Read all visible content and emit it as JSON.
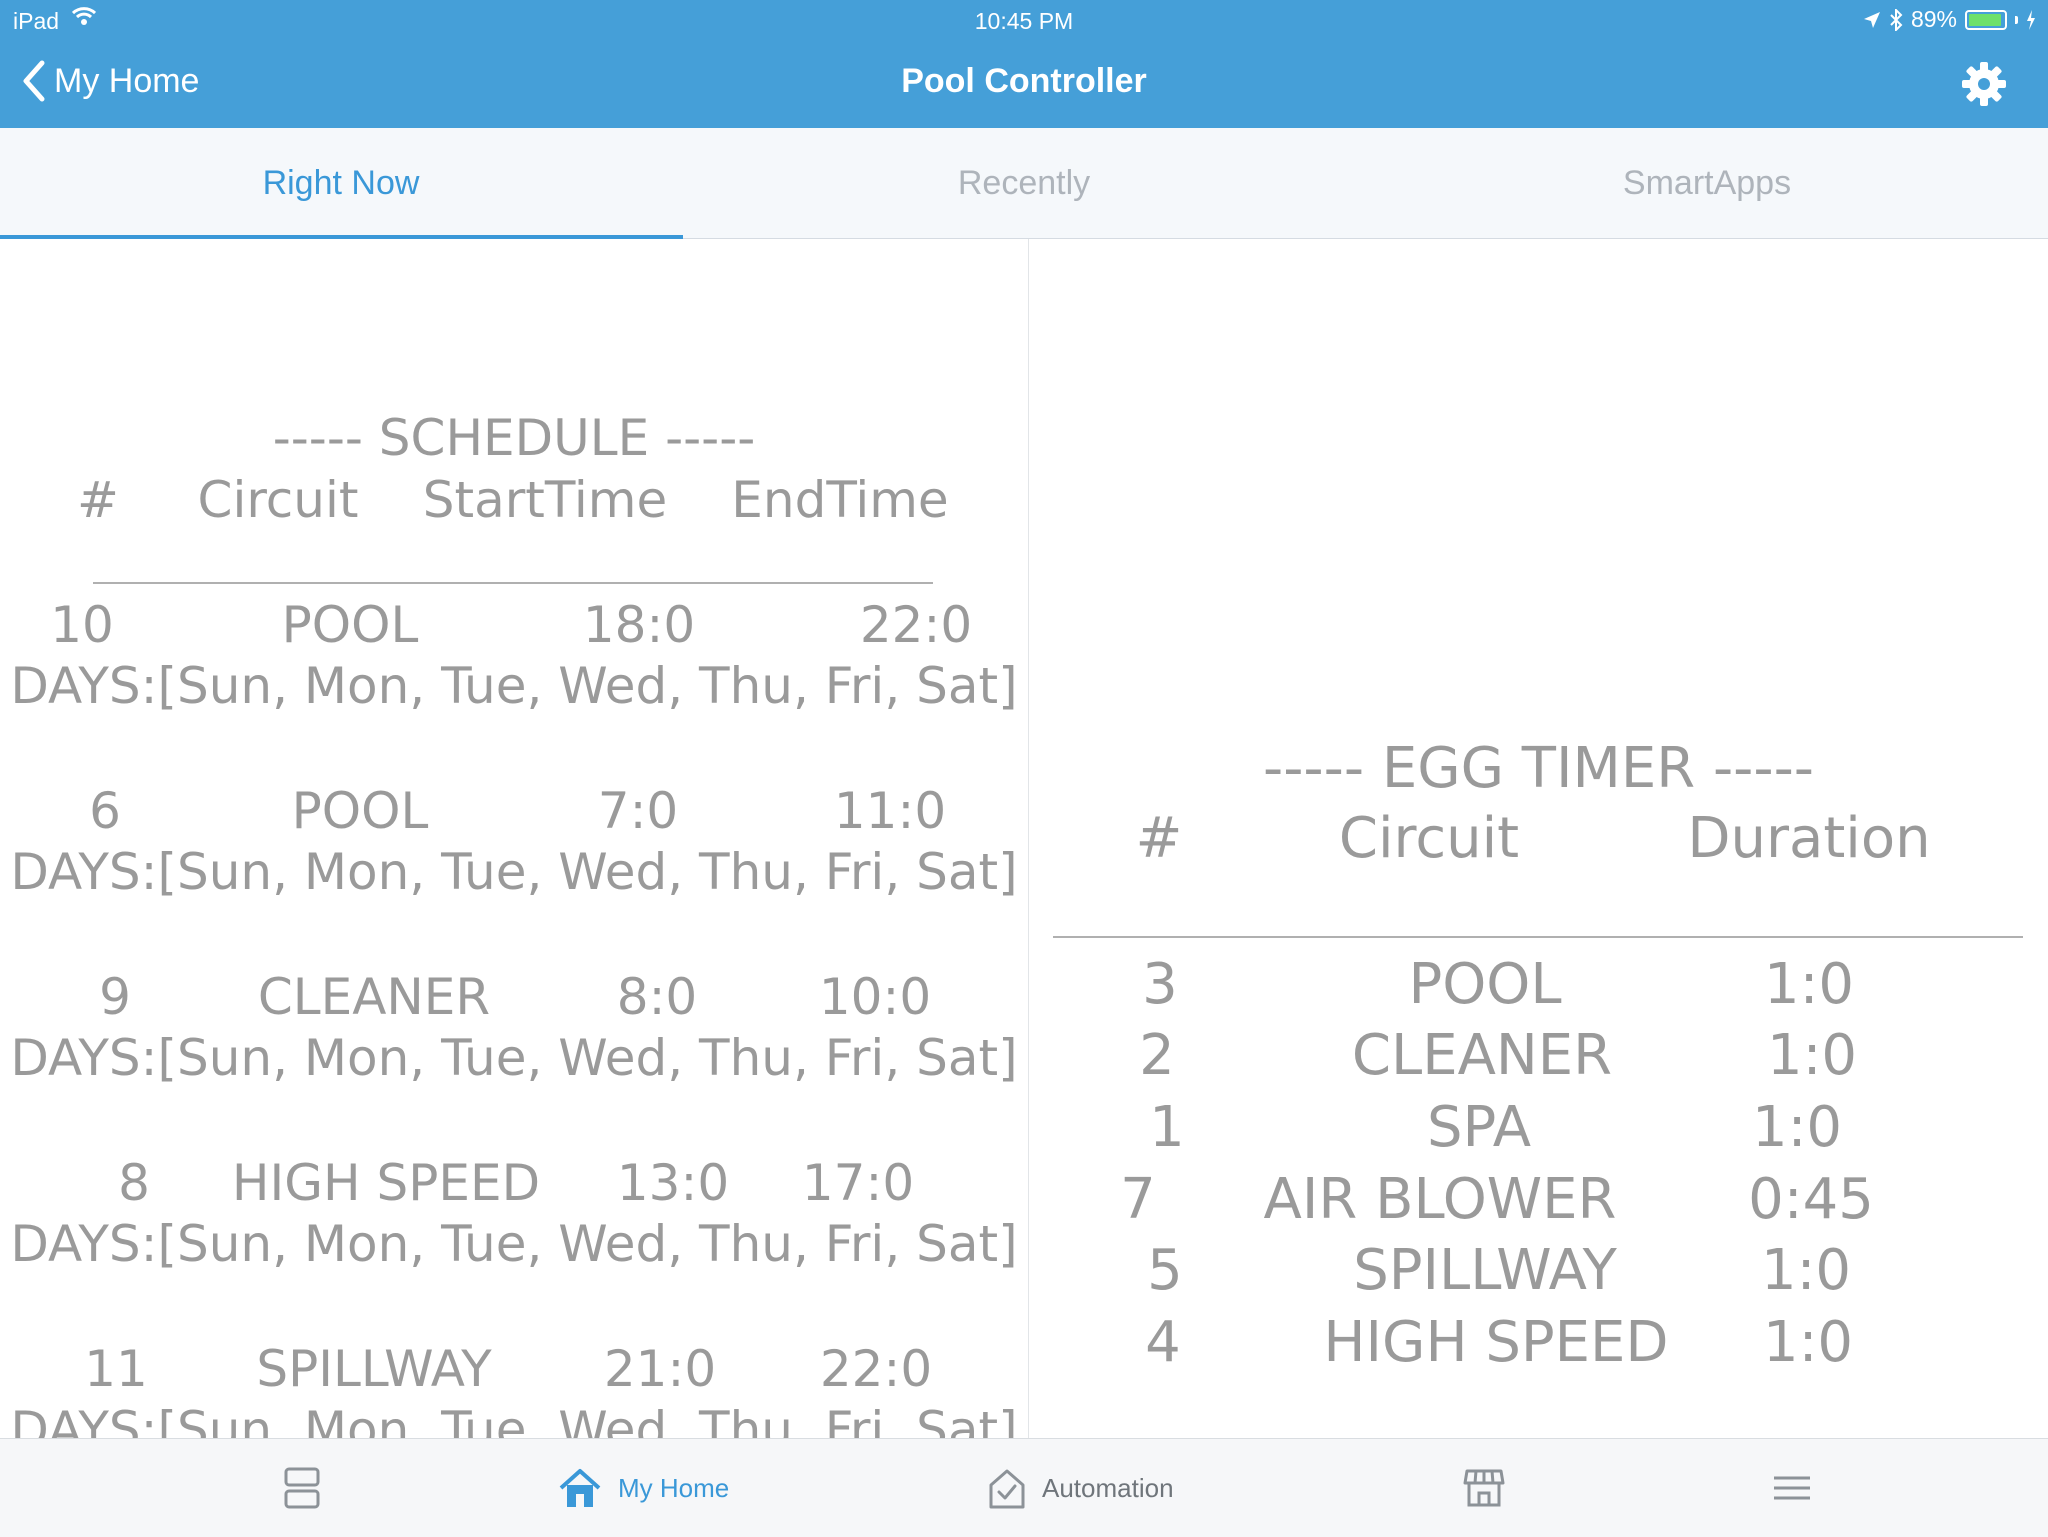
{
  "status_bar": {
    "device": "iPad",
    "time": "10:45 PM",
    "battery": "89%"
  },
  "header": {
    "back_label": "My Home",
    "title": "Pool Controller"
  },
  "tabs": [
    {
      "label": "Right Now",
      "active": true
    },
    {
      "label": "Recently",
      "active": false
    },
    {
      "label": "SmartApps",
      "active": false
    }
  ],
  "schedule": {
    "title": "----- SCHEDULE -----",
    "columns": [
      "#",
      "Circuit",
      "StartTime",
      "EndTime"
    ],
    "rows": [
      {
        "num": "10",
        "circuit": "POOL",
        "start": "18:0",
        "end": "22:0",
        "days": "DAYS:[Sun, Mon, Tue, Wed, Thu, Fri, Sat]"
      },
      {
        "num": "6",
        "circuit": "POOL",
        "start": "7:0",
        "end": "11:0",
        "days": "DAYS:[Sun, Mon, Tue, Wed, Thu, Fri, Sat]"
      },
      {
        "num": "9",
        "circuit": "CLEANER",
        "start": "8:0",
        "end": "10:0",
        "days": "DAYS:[Sun, Mon, Tue, Wed, Thu, Fri, Sat]"
      },
      {
        "num": "8",
        "circuit": "HIGH SPEED",
        "start": "13:0",
        "end": "17:0",
        "days": "DAYS:[Sun, Mon, Tue, Wed, Thu, Fri, Sat]"
      },
      {
        "num": "11",
        "circuit": "SPILLWAY",
        "start": "21:0",
        "end": "22:0",
        "days": "DAYS:[Sun, Mon, Tue, Wed, Thu, Fri, Sat]"
      }
    ]
  },
  "egg_timer": {
    "title": "----- EGG TIMER -----",
    "columns": [
      "#",
      "Circuit",
      "Duration"
    ],
    "rows": [
      {
        "num": "3",
        "circuit": "POOL",
        "duration": "1:0"
      },
      {
        "num": "2",
        "circuit": "CLEANER",
        "duration": "1:0"
      },
      {
        "num": "1",
        "circuit": "SPA",
        "duration": "1:0"
      },
      {
        "num": "7",
        "circuit": "AIR BLOWER",
        "duration": "0:45"
      },
      {
        "num": "5",
        "circuit": "SPILLWAY",
        "duration": "1:0"
      },
      {
        "num": "4",
        "circuit": "HIGH SPEED",
        "duration": "1:0"
      }
    ]
  },
  "bottom_nav": [
    {
      "label": "",
      "icon": "dashboard-icon"
    },
    {
      "label": "My Home",
      "icon": "home-icon",
      "active": true
    },
    {
      "label": "Automation",
      "icon": "automation-icon"
    },
    {
      "label": "",
      "icon": "marketplace-icon"
    },
    {
      "label": "",
      "icon": "menu-icon"
    }
  ],
  "colors": {
    "header": "#459fd8",
    "accent": "#3a98d8",
    "text_gray": "#9a9a9a"
  }
}
